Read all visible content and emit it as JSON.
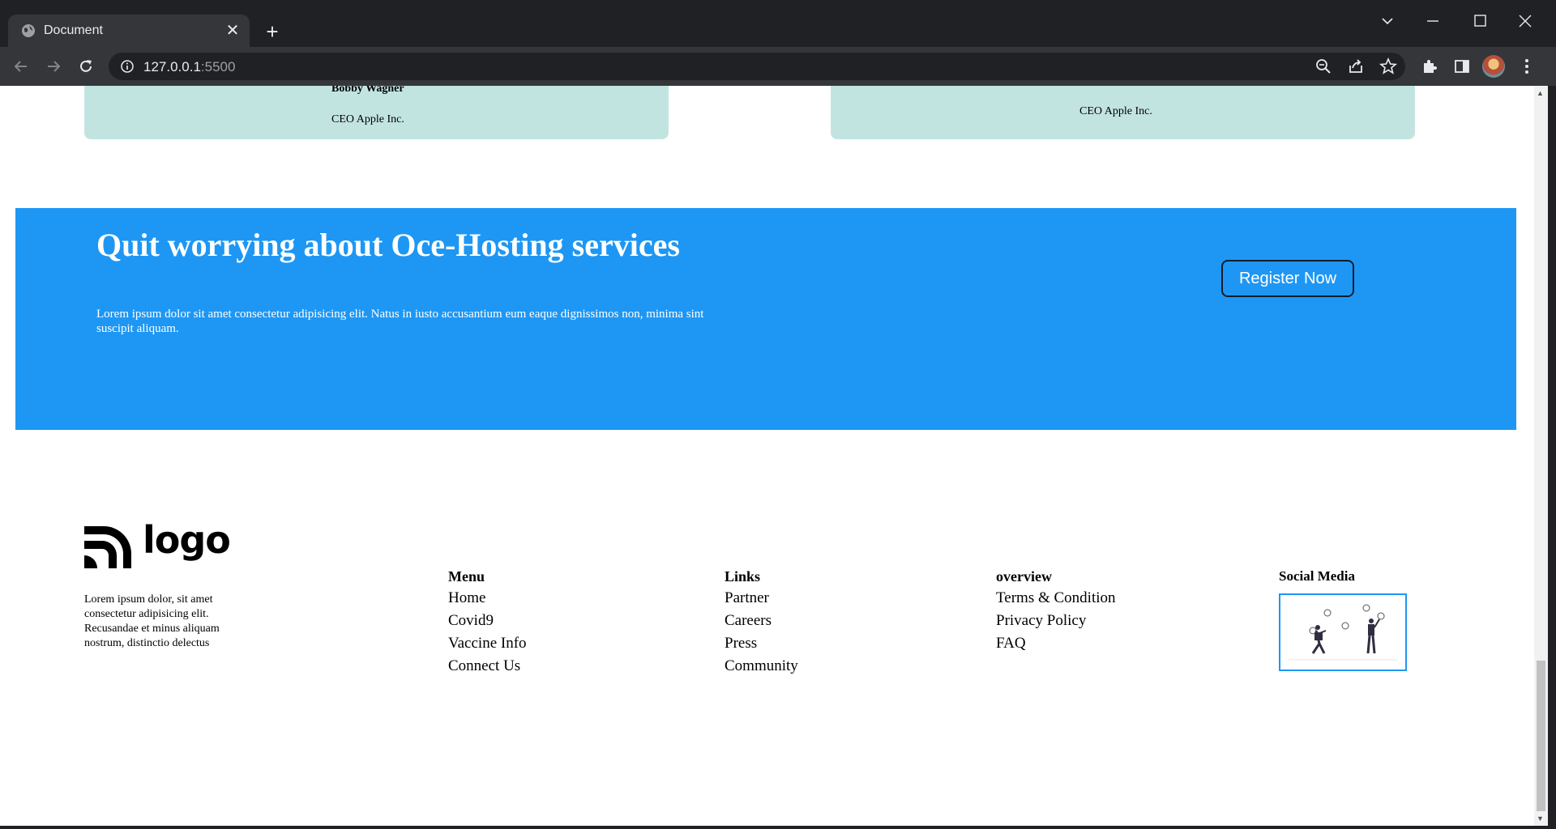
{
  "browser": {
    "tab_title": "Document",
    "url_host": "127.0.0.1",
    "url_port": ":5500"
  },
  "testimonials": [
    {
      "name": "Bobby Wagner",
      "role": "CEO Apple Inc."
    },
    {
      "name": "",
      "role": "CEO Apple Inc."
    }
  ],
  "cta": {
    "title": "Quit worrying about Oce-Hosting services",
    "text": "Lorem ipsum dolor sit amet consectetur adipisicing elit. Natus in iusto accusantium eum eaque dignissimos non, minima sint suscipit aliquam.",
    "button": "Register Now",
    "background": "#1e97f4"
  },
  "footer": {
    "logo_text": "logo",
    "about": "Lorem ipsum dolor, sit amet consectetur adipisicing elit. Recusandae et minus aliquam nostrum, distinctio delectus",
    "menu": {
      "title": "Menu",
      "items": [
        "Home",
        "Covid9",
        "Vaccine Info",
        "Connect Us"
      ]
    },
    "links": {
      "title": "Links",
      "items": [
        "Partner",
        "Careers",
        "Press",
        "Community"
      ]
    },
    "overview": {
      "title": "overview",
      "items": [
        "Terms & Condition",
        "Privacy Policy",
        "FAQ"
      ]
    },
    "social": {
      "title": "Social Media"
    }
  }
}
